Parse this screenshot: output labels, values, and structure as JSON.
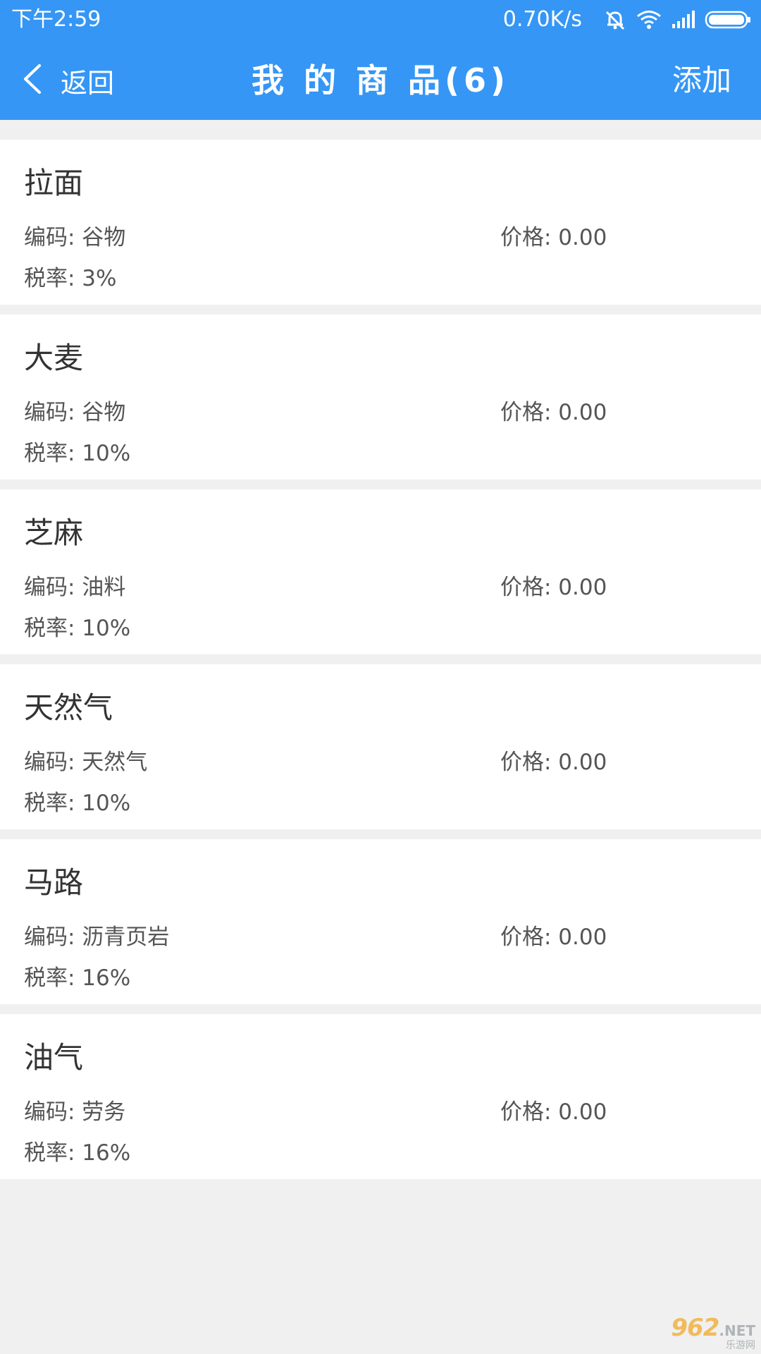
{
  "status_bar": {
    "time": "下午2:59",
    "net_speed": "0.70K/s",
    "icons": [
      "mute-icon",
      "wifi-icon",
      "signal-icon",
      "battery-icon"
    ]
  },
  "header": {
    "back_label": "返回",
    "title": "我 的 商 品(6)",
    "action_label": "添加",
    "background": "#3596f5"
  },
  "products": [
    {
      "name": "拉面",
      "code": "编码: 谷物",
      "price": "价格: 0.00",
      "tax": "税率: 3%"
    },
    {
      "name": "大麦",
      "code": "编码: 谷物",
      "price": "价格: 0.00",
      "tax": "税率: 10%"
    },
    {
      "name": "芝麻",
      "code": "编码: 油料",
      "price": "价格: 0.00",
      "tax": "税率: 10%"
    },
    {
      "name": "天然气",
      "code": "编码: 天然气",
      "price": "价格: 0.00",
      "tax": "税率: 10%"
    },
    {
      "name": "马路",
      "code": "编码: 沥青页岩",
      "price": "价格: 0.00",
      "tax": "税率: 16%"
    },
    {
      "name": "油气",
      "code": "编码: 劳务",
      "price": "价格: 0.00",
      "tax": "税率: 16%"
    }
  ],
  "watermark": {
    "main": "962",
    "net": ".NET",
    "sub": "乐游网"
  }
}
